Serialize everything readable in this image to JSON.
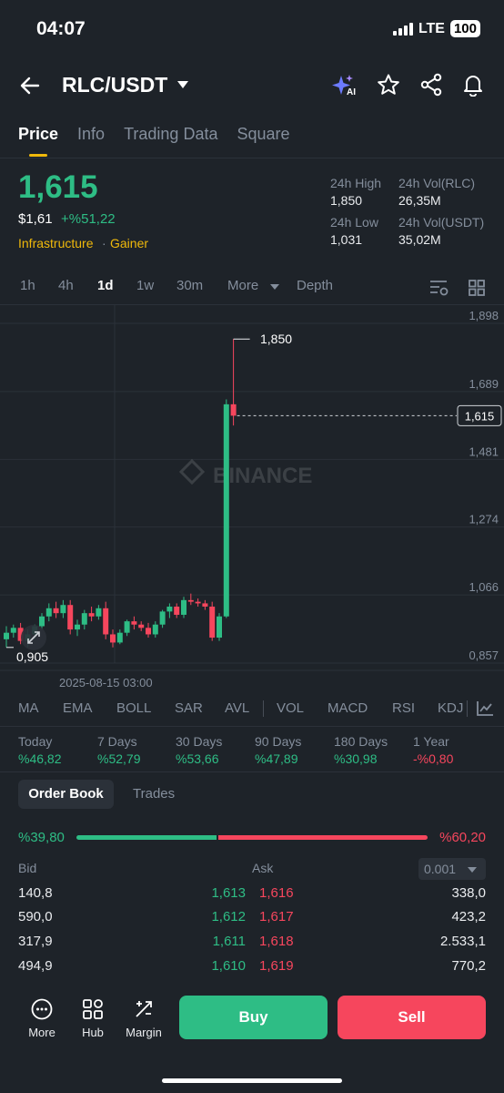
{
  "status": {
    "time": "04:07",
    "network": "LTE",
    "battery": "100"
  },
  "header": {
    "pair": "RLC/USDT",
    "ai_badge": "AI"
  },
  "tabs": [
    {
      "label": "Price",
      "active": true
    },
    {
      "label": "Info"
    },
    {
      "label": "Trading Data"
    },
    {
      "label": "Square"
    }
  ],
  "ticker": {
    "last_price": "1,615",
    "usd_price": "$1,61",
    "change": "+%51,22",
    "tag1": "Infrastructure",
    "tag2": "Gainer",
    "high_label": "24h High",
    "high": "1,850",
    "low_label": "24h Low",
    "low": "1,031",
    "vol_base_label": "24h Vol(RLC)",
    "vol_base": "26,35M",
    "vol_quote_label": "24h Vol(USDT)",
    "vol_quote": "35,02M"
  },
  "intervals": {
    "i1": "1h",
    "i2": "4h",
    "i3": "1d",
    "i4": "1w",
    "i5": "30m",
    "more": "More",
    "depth": "Depth"
  },
  "chart_data": {
    "type": "candlestick",
    "y_ticks": [
      "1,898",
      "1,689",
      "1,481",
      "1,274",
      "1,066",
      "0,857"
    ],
    "ylim": [
      0.857,
      1.898
    ],
    "current_price": "1,615",
    "high_marker": "1,850",
    "low_marker": "0,905",
    "x_label": "2025-08-15 03:00",
    "watermark": "BINANCE",
    "colors": {
      "up": "#2ebd85",
      "down": "#f6465d"
    },
    "candles": [
      {
        "o": 0.93,
        "h": 0.97,
        "l": 0.905,
        "c": 0.95
      },
      {
        "o": 0.95,
        "h": 0.975,
        "l": 0.935,
        "c": 0.965
      },
      {
        "o": 0.965,
        "h": 0.98,
        "l": 0.915,
        "c": 0.925
      },
      {
        "o": 0.925,
        "h": 0.96,
        "l": 0.905,
        "c": 0.945
      },
      {
        "o": 0.945,
        "h": 0.975,
        "l": 0.93,
        "c": 0.97
      },
      {
        "o": 0.97,
        "h": 1.01,
        "l": 0.96,
        "c": 1.0
      },
      {
        "o": 1.0,
        "h": 1.04,
        "l": 0.985,
        "c": 1.025
      },
      {
        "o": 1.025,
        "h": 1.045,
        "l": 0.995,
        "c": 1.01
      },
      {
        "o": 1.01,
        "h": 1.05,
        "l": 0.995,
        "c": 1.035
      },
      {
        "o": 1.035,
        "h": 1.05,
        "l": 0.945,
        "c": 0.96
      },
      {
        "o": 0.96,
        "h": 0.99,
        "l": 0.94,
        "c": 0.975
      },
      {
        "o": 0.975,
        "h": 1.02,
        "l": 0.96,
        "c": 1.01
      },
      {
        "o": 1.01,
        "h": 1.03,
        "l": 0.985,
        "c": 1.0
      },
      {
        "o": 1.0,
        "h": 1.035,
        "l": 0.99,
        "c": 1.025
      },
      {
        "o": 1.025,
        "h": 1.045,
        "l": 0.93,
        "c": 0.945
      },
      {
        "o": 0.945,
        "h": 0.96,
        "l": 0.905,
        "c": 0.92
      },
      {
        "o": 0.92,
        "h": 0.96,
        "l": 0.915,
        "c": 0.95
      },
      {
        "o": 0.95,
        "h": 0.99,
        "l": 0.94,
        "c": 0.985
      },
      {
        "o": 0.985,
        "h": 1.0,
        "l": 0.96,
        "c": 0.975
      },
      {
        "o": 0.975,
        "h": 0.985,
        "l": 0.955,
        "c": 0.965
      },
      {
        "o": 0.965,
        "h": 0.98,
        "l": 0.935,
        "c": 0.945
      },
      {
        "o": 0.945,
        "h": 0.985,
        "l": 0.935,
        "c": 0.975
      },
      {
        "o": 0.975,
        "h": 1.02,
        "l": 0.965,
        "c": 1.015
      },
      {
        "o": 1.015,
        "h": 1.04,
        "l": 0.995,
        "c": 1.03
      },
      {
        "o": 1.03,
        "h": 1.04,
        "l": 0.995,
        "c": 1.005
      },
      {
        "o": 1.005,
        "h": 1.06,
        "l": 0.995,
        "c": 1.05
      },
      {
        "o": 1.05,
        "h": 1.07,
        "l": 1.035,
        "c": 1.045
      },
      {
        "o": 1.045,
        "h": 1.055,
        "l": 1.03,
        "c": 1.04
      },
      {
        "o": 1.04,
        "h": 1.05,
        "l": 1.02,
        "c": 1.03
      },
      {
        "o": 1.03,
        "h": 1.045,
        "l": 0.925,
        "c": 0.935
      },
      {
        "o": 0.935,
        "h": 1.01,
        "l": 0.925,
        "c": 1.0
      },
      {
        "o": 1.0,
        "h": 1.665,
        "l": 0.995,
        "c": 1.65
      },
      {
        "o": 1.65,
        "h": 1.85,
        "l": 1.585,
        "c": 1.615
      }
    ]
  },
  "indicators": {
    "ma": "MA",
    "ema": "EMA",
    "boll": "BOLL",
    "sar": "SAR",
    "avl": "AVL",
    "vol": "VOL",
    "macd": "MACD",
    "rsi": "RSI",
    "kdj": "KDJ"
  },
  "performance": [
    {
      "label": "Today",
      "value": "%46,82"
    },
    {
      "label": "7 Days",
      "value": "%52,79"
    },
    {
      "label": "30 Days",
      "value": "%53,66"
    },
    {
      "label": "90 Days",
      "value": "%47,89"
    },
    {
      "label": "180 Days",
      "value": "%30,98"
    },
    {
      "label": "1 Year",
      "value": "-%0,80"
    }
  ],
  "order_book": {
    "tab_active": "Order Book",
    "tab_other": "Trades",
    "bid_ratio": "%39,80",
    "ask_ratio": "%60,20",
    "bid_fraction": 0.398,
    "bid_label": "Bid",
    "ask_label": "Ask",
    "precision": "0.001",
    "rows": [
      {
        "bid_qty": "140,8",
        "bid_price": "1,613",
        "ask_price": "1,616",
        "ask_qty": "338,0"
      },
      {
        "bid_qty": "590,0",
        "bid_price": "1,612",
        "ask_price": "1,617",
        "ask_qty": "423,2"
      },
      {
        "bid_qty": "317,9",
        "bid_price": "1,611",
        "ask_price": "1,618",
        "ask_qty": "2.533,1"
      },
      {
        "bid_qty": "494,9",
        "bid_price": "1,610",
        "ask_price": "1,619",
        "ask_qty": "770,2"
      }
    ]
  },
  "bottom_nav": {
    "more": "More",
    "hub": "Hub",
    "margin": "Margin",
    "buy": "Buy",
    "sell": "Sell"
  }
}
